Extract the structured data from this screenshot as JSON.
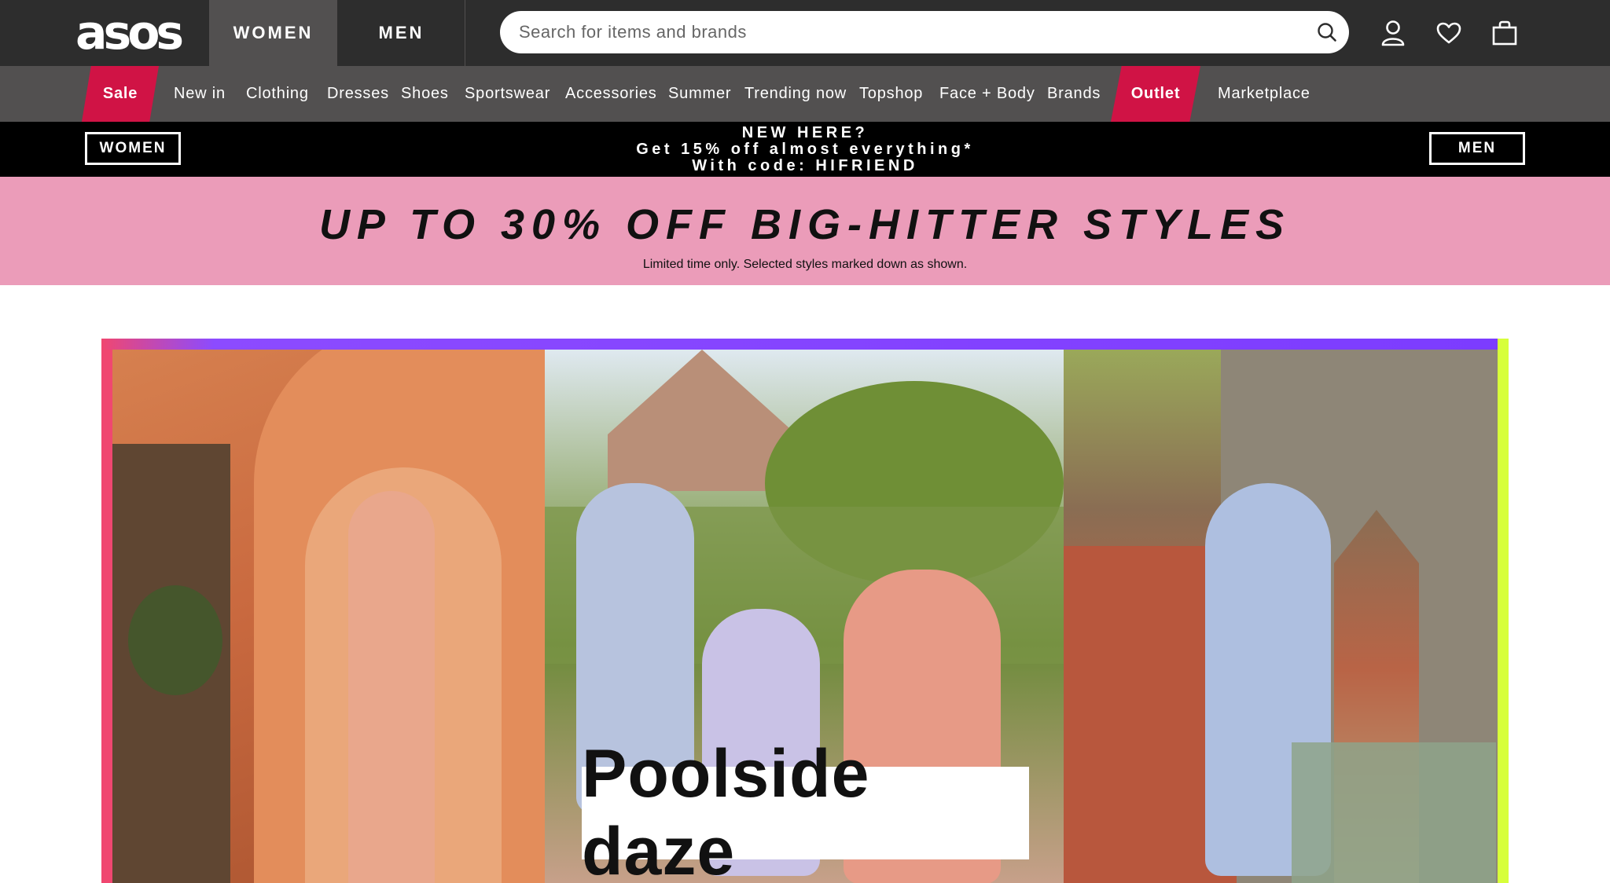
{
  "header": {
    "logo": "asos",
    "tabs": [
      {
        "label": "WOMEN",
        "active": true
      },
      {
        "label": "MEN",
        "active": false
      }
    ],
    "search": {
      "placeholder": "Search for items and brands",
      "value": ""
    },
    "icons": [
      "search-icon",
      "account-icon",
      "heart-icon",
      "bag-icon"
    ]
  },
  "nav": {
    "items": [
      {
        "label": "Sale",
        "promo": true
      },
      {
        "label": "New in"
      },
      {
        "label": "Clothing"
      },
      {
        "label": "Dresses"
      },
      {
        "label": "Shoes"
      },
      {
        "label": "Sportswear"
      },
      {
        "label": "Accessories"
      },
      {
        "label": "Summer"
      },
      {
        "label": "Trending now"
      },
      {
        "label": "Topshop"
      },
      {
        "label": "Face + Body"
      },
      {
        "label": "Brands"
      },
      {
        "label": "Outlet",
        "promo": true
      },
      {
        "label": "Marketplace"
      }
    ]
  },
  "newhere": {
    "women_label": "WOMEN",
    "men_label": "MEN",
    "line1": "NEW HERE?",
    "line2": "Get 15% off almost everything*",
    "line3": "With code: HIFRIEND"
  },
  "promo": {
    "title": "UP TO 30% OFF BIG-HITTER STYLES",
    "subtitle": "Limited time only. Selected styles marked down as shown."
  },
  "hero": {
    "label": "Poolside daze"
  },
  "colors": {
    "header_bg": "#2d2d2d",
    "nav_bg": "#525050",
    "sale_red": "#d01345",
    "promo_pink": "#eb9cb9"
  }
}
